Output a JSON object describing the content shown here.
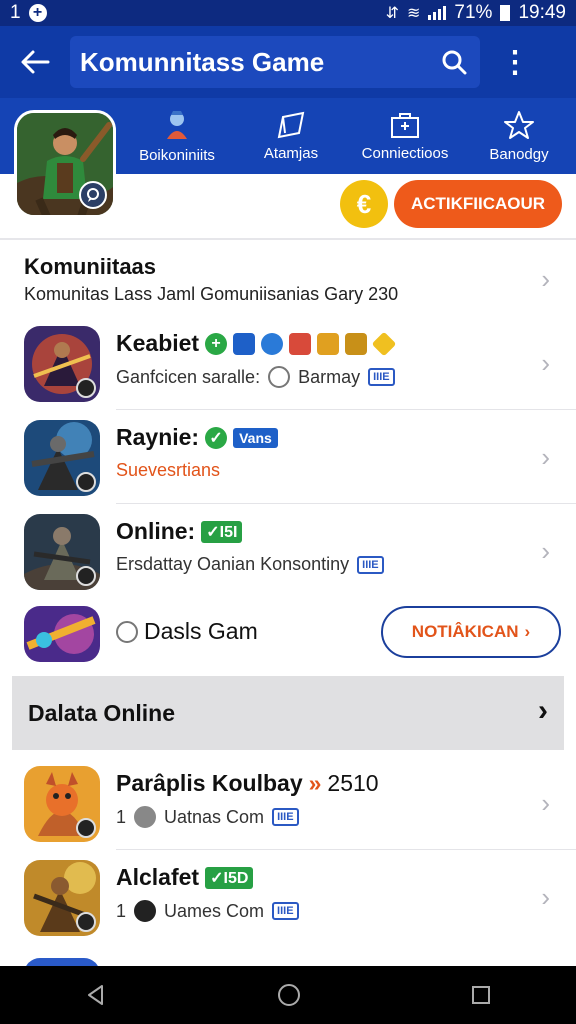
{
  "status_bar": {
    "notification_count": "1",
    "battery_percent": "71%",
    "time": "19:49"
  },
  "app_bar": {
    "title": "Komunnitass Game"
  },
  "tabs": [
    {
      "label": "Boikoniniits",
      "icon": "hero-icon"
    },
    {
      "label": "Atamjas",
      "icon": "flag-icon"
    },
    {
      "label": "Conniectioos",
      "icon": "briefcase-icon"
    },
    {
      "label": "Banodgy",
      "icon": "star-icon"
    }
  ],
  "actions": {
    "coin_symbol": "€",
    "activate_label": "ACTIKFIICAOUR"
  },
  "section1": {
    "title": "Komuniitaas",
    "subtitle": "Komunitas Lass Jaml Gomuniisanias Gary 230"
  },
  "items": [
    {
      "name": "Keabiet",
      "sub": "Ganfcicen saralle:",
      "sub_extra": "Barmay",
      "kbd": "IIIE"
    },
    {
      "name": "Raynie:",
      "badge": "Vans",
      "sub": "Suevesrtians"
    },
    {
      "name": "Online:",
      "badge": "✓I5I",
      "sub": "Ersdattay Oanian Konsontiny",
      "kbd": "IIIE"
    },
    {
      "name": "Dasls Gam",
      "button": "NOTIÂKICAN"
    }
  ],
  "section2": {
    "title": "Dalata Online"
  },
  "items2": [
    {
      "name": "Parâplis Koulbay",
      "badge": "»",
      "count": "2510",
      "sub_prefix": "1",
      "sub": "Uatnas Com",
      "kbd": "IIIE"
    },
    {
      "name": "Alclafet",
      "badge": "✓I5D",
      "sub_prefix": "1",
      "sub": "Uames Com",
      "kbd": "IIIE"
    }
  ],
  "colors": {
    "app_bar": "#0f3aa6",
    "header": "#1544b5",
    "accent_orange": "#ee5a1b",
    "coin_yellow": "#f2c00f",
    "green": "#27a044"
  }
}
